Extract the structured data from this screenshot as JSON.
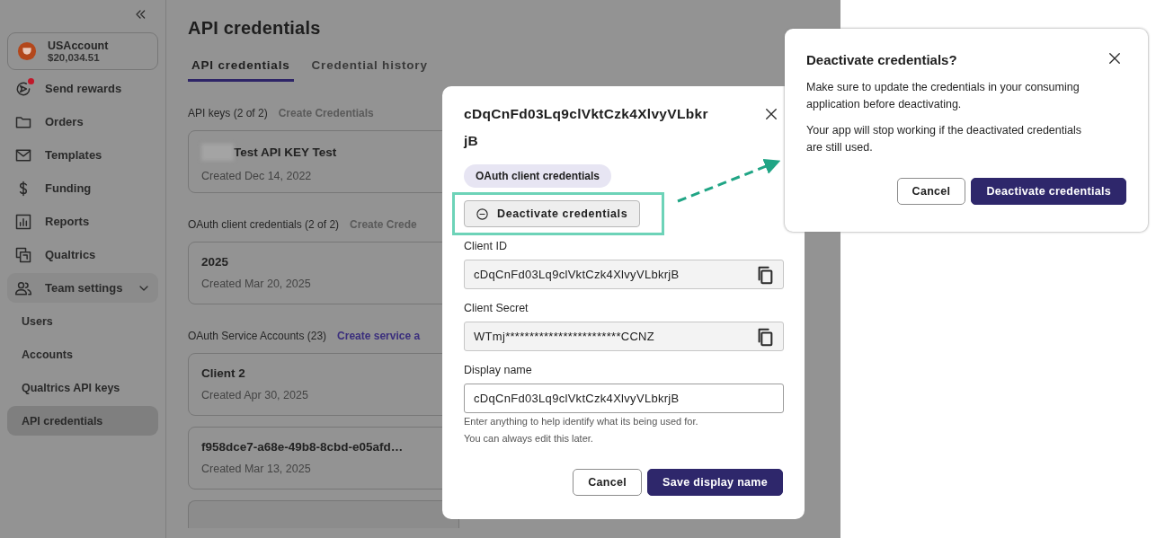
{
  "sidebar": {
    "account": {
      "name": "USAccount",
      "balance": "$20,034.51"
    },
    "items": [
      {
        "label": "Send rewards",
        "notification": true,
        "selected": false
      },
      {
        "label": "Orders",
        "notification": false,
        "selected": false
      },
      {
        "label": "Templates",
        "notification": false,
        "selected": false
      },
      {
        "label": "Funding",
        "notification": false,
        "selected": false
      },
      {
        "label": "Reports",
        "notification": false,
        "selected": false
      },
      {
        "label": "Qualtrics",
        "notification": false,
        "selected": false
      },
      {
        "label": "Team settings",
        "notification": false,
        "selected": false,
        "expanded": true,
        "children": [
          {
            "label": "Users",
            "selected": false
          },
          {
            "label": "Accounts",
            "selected": false
          },
          {
            "label": "Qualtrics API keys",
            "selected": false
          },
          {
            "label": "API credentials",
            "selected": true
          }
        ]
      }
    ]
  },
  "page": {
    "title": "API credentials",
    "tabs": [
      {
        "label": "API credentials",
        "selected": true
      },
      {
        "label": "Credential history",
        "selected": false
      }
    ],
    "sections": [
      {
        "heading": "API keys (2 of 2)",
        "action": "Create Credentials",
        "disabled": true,
        "cards": [
          {
            "name": "Test API KEY Test",
            "redacted": true,
            "created": "Created Dec 14, 2022"
          }
        ]
      },
      {
        "heading": "OAuth client credentials (2 of 2)",
        "action": "Create Crede",
        "disabled": true,
        "cards": [
          {
            "name": "2025",
            "redacted": false,
            "created": "Created Mar 20, 2025"
          }
        ]
      },
      {
        "heading": "OAuth Service Accounts (23)",
        "action": "Create service a",
        "disabled": false,
        "cards": [
          {
            "name": "Client 2",
            "redacted": false,
            "created": "Created Apr 30, 2025"
          },
          {
            "name": "f958dce7-a68e-49b8-8cbd-e05afd…",
            "redacted": false,
            "created": "Created Mar 13, 2025"
          }
        ]
      }
    ]
  },
  "details_dialog": {
    "title": "cDqCnFd03Lq9clVktCzk4XlvyVLbkrjB",
    "tag": "OAuth client credentials",
    "deactivate_button": "Deactivate credentials",
    "fields": [
      {
        "label": "Client ID",
        "value": "cDqCnFd03Lq9clVktCzk4XlvyVLbkrjB",
        "kind": "readonly"
      },
      {
        "label": "Client Secret",
        "value": "WTmj************************CCNZ",
        "kind": "readonly"
      },
      {
        "label": "Display name",
        "value": "cDqCnFd03Lq9clVktCzk4XlvyVLbkrjB",
        "kind": "editable",
        "help": [
          "Enter anything to help identify what its being used for.",
          "You can always edit this later."
        ]
      }
    ],
    "buttons": [
      {
        "label": "Cancel",
        "kind": "secondary"
      },
      {
        "label": "Save display name",
        "kind": "primary"
      }
    ]
  },
  "confirm_dialog": {
    "title": "Deactivate credentials?",
    "paragraphs": [
      "Make sure to update the credentials in your consuming application before deactivating.",
      "Your app will stop working if the deactivated credentials are still used."
    ],
    "buttons": [
      {
        "label": "Cancel",
        "kind": "secondary"
      },
      {
        "label": "Deactivate credentials",
        "kind": "primary"
      }
    ]
  }
}
